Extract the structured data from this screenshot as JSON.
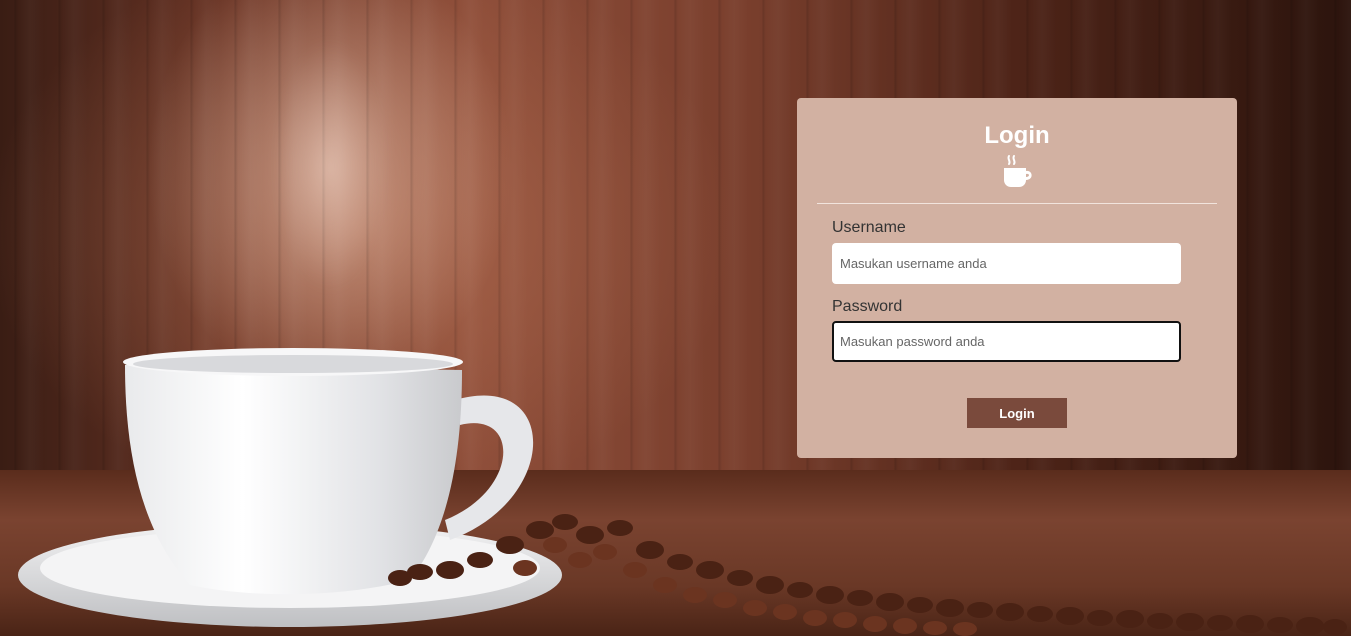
{
  "login": {
    "title": "Login",
    "icon": "coffee-cup-icon",
    "username_label": "Username",
    "username_placeholder": "Masukan username anda",
    "password_label": "Password",
    "password_placeholder": "Masukan password anda",
    "submit_label": "Login"
  },
  "colors": {
    "card_background": "#d2b1a2",
    "button_background": "#7a4a3c",
    "title_color": "#ffffff"
  }
}
